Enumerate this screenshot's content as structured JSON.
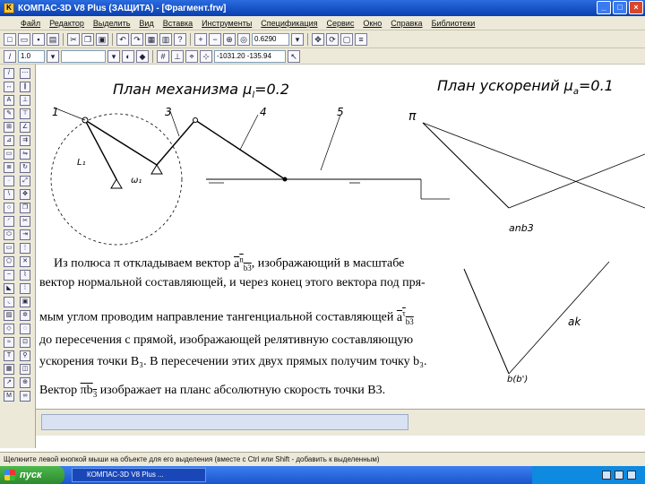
{
  "window": {
    "title": "КОМПАС-3D V8 Plus (ЗАЩИТА) - [Фрагмент.frw]",
    "controls": [
      "_",
      "□",
      "×"
    ]
  },
  "menu": [
    "Файл",
    "Редактор",
    "Выделить",
    "Вид",
    "Вставка",
    "Инструменты",
    "Спецификация",
    "Сервис",
    "Окно",
    "Справка",
    "Библиотеки"
  ],
  "toolbar": {
    "zoom_value": "0.6290",
    "layer_value": "1.0",
    "coords_value": "-1031.20  -135.94"
  },
  "drawing": {
    "mech_title": "План механизма μ",
    "mech_scale": "=0.2",
    "acc_title": "План ускорений μ",
    "acc_scale": "=0.1",
    "labels": {
      "n1": "1",
      "n3": "3",
      "n4": "4",
      "n5": "5",
      "pi": "π",
      "a_ns3": "anb3",
      "a_k": "ak",
      "b3": "b(b')",
      "l_label": "L₁",
      "omega": "ω₁"
    }
  },
  "text": {
    "line1_a": "Из полюса π откладываем вектор",
    "line1_vec": "a",
    "line1_b": ", изображающий в масштабе",
    "line2": "вектор нормальной составляющей, и через конец этого вектора под пря-",
    "line3_a": "мым углом проводим направление тангенциальной составляющей",
    "line3_vec": "a",
    "line4": "до пересечения с прямой, изображающей релятивную составляющую",
    "line5": "ускорения точки B₃. В пересечении этих двух прямых получим точку b₃.",
    "line6_a": "Вектор",
    "line6_vec": "πb",
    "line6_b": "изображает на планс абсолютную скорость точки B3.",
    "sub_nb3_sup": "n",
    "sub_b3": "b3",
    "sub_tau": "τ",
    "sub_3": "3"
  },
  "status": "Щелкните левой кнопкой мыши на объекте для его выделения (вместе с Ctrl или Shift - добавить к выделенным)",
  "taskbar": {
    "start": "пуск",
    "task_item": "КОМПАС-3D V8 Plus ...",
    "clock": "",
    "tray_icons": [
      "network-icon",
      "volume-icon",
      "security-icon"
    ]
  },
  "colors": {
    "title_blue": "#0a3fb0",
    "taskbar_blue": "#1c54cc",
    "start_green": "#2d8a2d",
    "panel": "#ece9d8"
  }
}
